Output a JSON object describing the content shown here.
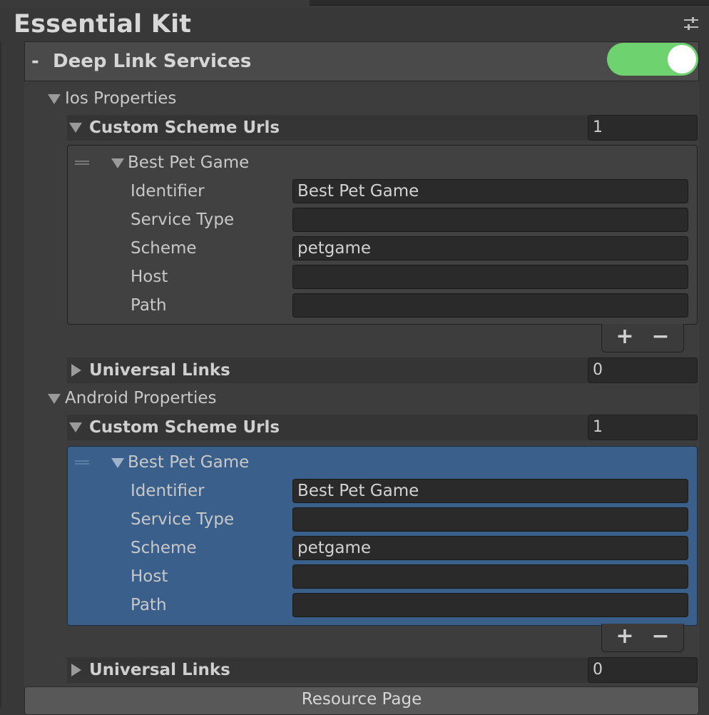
{
  "header": {
    "title": "Essential Kit",
    "settings_icon": "sliders-icon"
  },
  "section": {
    "collapse_symbol": "-",
    "title": "Deep Link Services",
    "toggle_on": true,
    "toggle_color": "#6ed26e"
  },
  "ios": {
    "label": "Ios Properties",
    "custom_scheme": {
      "label": "Custom Scheme Urls",
      "count": "1",
      "item": {
        "name": "Best Pet Game",
        "labels": {
          "identifier": "Identifier",
          "service_type": "Service Type",
          "scheme": "Scheme",
          "host": "Host",
          "path": "Path"
        },
        "values": {
          "identifier": "Best Pet Game",
          "service_type": "",
          "scheme": "petgame",
          "host": "",
          "path": ""
        }
      }
    },
    "universal_links": {
      "label": "Universal Links",
      "count": "0"
    }
  },
  "android": {
    "label": "Android Properties",
    "custom_scheme": {
      "label": "Custom Scheme Urls",
      "count": "1",
      "item": {
        "name": "Best Pet Game",
        "labels": {
          "identifier": "Identifier",
          "service_type": "Service Type",
          "scheme": "Scheme",
          "host": "Host",
          "path": "Path"
        },
        "values": {
          "identifier": "Best Pet Game",
          "service_type": "",
          "scheme": "petgame",
          "host": "",
          "path": ""
        }
      }
    },
    "universal_links": {
      "label": "Universal Links",
      "count": "0"
    }
  },
  "list_controls": {
    "add": "+",
    "remove": "−"
  },
  "footer": {
    "resource_button": "Resource Page"
  },
  "colors": {
    "background": "#383838",
    "selected_item": "#3a5f8a",
    "field": "#2a2a2a"
  }
}
